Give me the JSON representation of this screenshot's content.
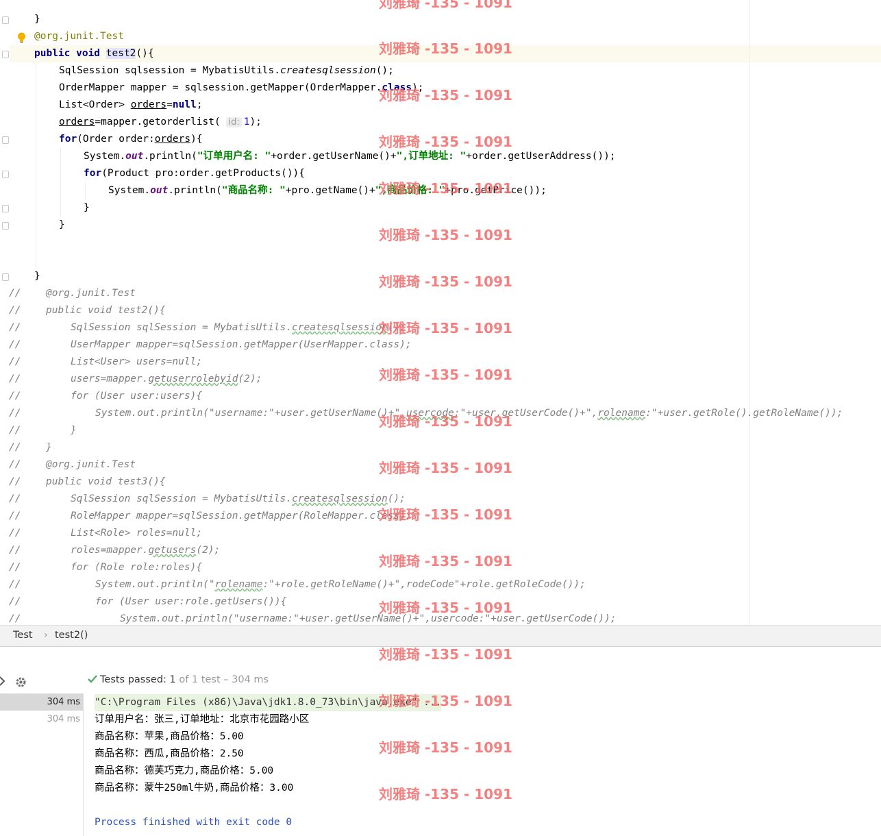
{
  "editor": {
    "code": {
      "l1": "}",
      "l2_ann": "@org.junit.",
      "l2_test": "Test",
      "l3_kw": "public void",
      "l3_name": "test2",
      "l3_rest": "(){",
      "l4_a": "SqlSession sqlsession = MybatisUtils.",
      "l4_b": "createsqlsession",
      "l4_c": "();",
      "l5_a": "OrderMapper mapper = sqlsession.getMapper(OrderMapper.",
      "l5_kw": "class",
      "l5_c": ");",
      "l6_a": "List<Order> ",
      "l6_var": "orders",
      "l6_b": "=",
      "l6_kw": "null",
      "l6_c": ";",
      "l7_var": "orders",
      "l7_a": "=mapper.getorderlist(",
      "l7_hint": "id:",
      "l7_num": "1",
      "l7_b": ");",
      "l8_kw": "for",
      "l8_a": "(Order order:",
      "l8_var": "orders",
      "l8_b": "){",
      "l9_a": "System.",
      "l9_out": "out",
      "l9_b": ".println(",
      "l9_s1": "\"订单用户名: \"",
      "l9_c": "+order.getUserName()+",
      "l9_s2": "\",订单地址: \"",
      "l9_d": "+order.getUserAddress());",
      "l10_kw": "for",
      "l10_a": "(Product pro:order.getProducts()){",
      "l11_a": "System.",
      "l11_out": "out",
      "l11_b": ".println(",
      "l11_s1": "\"商品名称: \"",
      "l11_c": "+pro.getName()+",
      "l11_s2": "\",商品价格: \"",
      "l11_d": "+pro.getPrice());",
      "l12": "}",
      "l13": "}",
      "l14": "}"
    },
    "comments": {
      "slash": "//",
      "c1": "@org.junit.Test",
      "c2": "public void test2(){",
      "c3_a": "SqlSession sqlSession = MybatisUtils.",
      "c3_b": "createsqlsession",
      "c3_c": "();",
      "c4": "UserMapper mapper=sqlSession.getMapper(UserMapper.class);",
      "c5": "List<User> users=null;",
      "c6_a": "users=mapper.",
      "c6_b": "getuserrolebyid",
      "c6_c": "(2);",
      "c7": "for (User user:users){",
      "c8_a": "System.out.println(\"username:\"+user.getUserName()+\",",
      "c8_b": "usercode",
      "c8_c": ":\"+user.getUserCode()+\",",
      "c8_d": "rolename",
      "c8_e": ":\"+user.getRole().getRoleName());",
      "c9": "}",
      "c10": "}",
      "c11": "@org.junit.Test",
      "c12": "public void test3(){",
      "c13_a": "SqlSession sqlSession = MybatisUtils.",
      "c13_b": "createsqlsession",
      "c13_c": "();",
      "c14": "RoleMapper mapper=sqlSession.getMapper(RoleMapper.class);",
      "c15": "List<Role> roles=null;",
      "c16_a": "roles=mapper.",
      "c16_b": "getusers",
      "c16_c": "(2);",
      "c17": "for (Role role:roles){",
      "c18_a": "System.out.println(\"",
      "c18_b": "rolename",
      "c18_c": ":\"+role.getRoleName()+\",rodeCode\"+role.getRoleCode());",
      "c19": "for (User user:role.getUsers()){",
      "c20": "System.out.println(\"username:\"+user.getUserName()+\",usercode:\"+user.getUserCode());"
    }
  },
  "breadcrumb": {
    "class_name": "Test",
    "separator": "›",
    "method_name": "test2()"
  },
  "run": {
    "status_prefix": "Tests passed:",
    "status_count": "1",
    "status_suffix": "of 1 test – 304 ms",
    "tree": [
      {
        "time": "304 ms"
      },
      {
        "time": "304 ms"
      }
    ],
    "console": {
      "cmd": "\"C:\\Program Files (x86)\\Java\\jdk1.8.0_73\\bin\\java.exe\" ...",
      "out1": "订单用户名：张三,订单地址：北京市花园路小区",
      "out2": "商品名称：苹果,商品价格：5.00",
      "out3": "商品名称：西瓜,商品价格：2.50",
      "out4": "商品名称：德芙巧克力,商品价格：5.00",
      "out5": "商品名称：蒙牛250ml牛奶,商品价格：3.00",
      "finish": "Process finished with exit code 0"
    }
  },
  "watermark": {
    "text": "刘雅琦 -135 - 1091"
  },
  "colors": {
    "keyword": "#000080",
    "string": "#008000",
    "comment": "#808080",
    "watermark": "#f36b6b",
    "pass_check": "#59a869"
  },
  "icons": [
    "lightbulb-icon",
    "fold-marker-icon",
    "settings-gear-icon",
    "check-icon",
    "pin-icon"
  ]
}
